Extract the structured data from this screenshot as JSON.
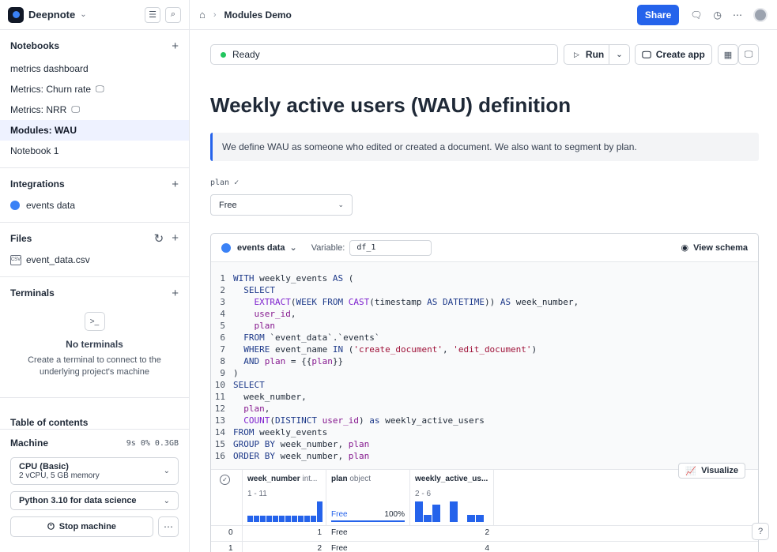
{
  "app": {
    "name": "Deepnote"
  },
  "sidebar": {
    "notebooks_title": "Notebooks",
    "notebooks": [
      {
        "label": "metrics dashboard",
        "app": false,
        "active": false
      },
      {
        "label": "Metrics: Churn rate",
        "app": true,
        "active": false
      },
      {
        "label": "Metrics: NRR",
        "app": true,
        "active": false
      },
      {
        "label": "Modules: WAU",
        "app": false,
        "active": true
      },
      {
        "label": "Notebook 1",
        "app": false,
        "active": false
      }
    ],
    "integrations_title": "Integrations",
    "integrations": [
      {
        "label": "events data"
      }
    ],
    "files_title": "Files",
    "files": [
      {
        "label": "event_data.csv",
        "icon_text": "CSV"
      }
    ],
    "terminals_title": "Terminals",
    "terminals_empty_title": "No terminals",
    "terminals_empty_sub": "Create a terminal to connect to the underlying project's machine",
    "toc_title": "Table of contents",
    "machine_title": "Machine",
    "machine_stats": "9s 0% 0.3GB",
    "machine_type": "CPU (Basic)",
    "machine_spec": "2 vCPU, 5 GB memory",
    "environment": "Python 3.10 for data science",
    "stop_label": "Stop machine"
  },
  "topbar": {
    "breadcrumb": "Modules Demo",
    "share_label": "Share"
  },
  "toolbar": {
    "status": "Ready",
    "run_label": "Run",
    "create_app_label": "Create app"
  },
  "notebook": {
    "title": "Weekly active users (WAU) definition",
    "callout": "We define WAU as someone who edited or created a document. We also want to segment by plan.",
    "plan_label": "plan",
    "plan_value": "Free"
  },
  "sql_cell": {
    "integration": "events data",
    "variable_label": "Variable:",
    "variable_value": "df_1",
    "view_schema": "View schema",
    "lines": [
      "WITH weekly_events AS (",
      "  SELECT",
      "    EXTRACT(WEEK FROM CAST(timestamp AS DATETIME)) AS week_number,",
      "    user_id,",
      "    plan",
      "  FROM `event_data`.`events`",
      "  WHERE event_name IN ('create_document', 'edit_document')",
      "  AND plan = {{plan}}",
      ")",
      "SELECT",
      "  week_number,",
      "  plan,",
      "  COUNT(DISTINCT user_id) as weekly_active_users",
      "FROM weekly_events",
      "GROUP BY week_number, plan",
      "ORDER BY week_number, plan"
    ]
  },
  "results": {
    "visualize_label": "Visualize",
    "columns": [
      {
        "name": "week_number",
        "type": "int...",
        "range": "1 - 11",
        "hist": [
          0.3,
          0.3,
          0.3,
          0.3,
          0.3,
          0.3,
          0.3,
          0.3,
          0.3,
          0.3,
          0.3,
          1.0
        ]
      },
      {
        "name": "plan",
        "type": "object",
        "top": "Free",
        "pct": "100%"
      },
      {
        "name": "weekly_active_us...",
        "type": "",
        "range": "2 - 6",
        "hist": [
          1.0,
          0.35,
          0.85,
          0,
          1.0,
          0,
          0.35,
          0.35
        ]
      }
    ],
    "rows": [
      {
        "index": "0",
        "week_number": "1",
        "plan": "Free",
        "wau": "2"
      },
      {
        "index": "1",
        "week_number": "2",
        "plan": "Free",
        "wau": "4"
      }
    ]
  },
  "colors": {
    "accent": "#2563eb",
    "status_ok": "#22c55e"
  }
}
